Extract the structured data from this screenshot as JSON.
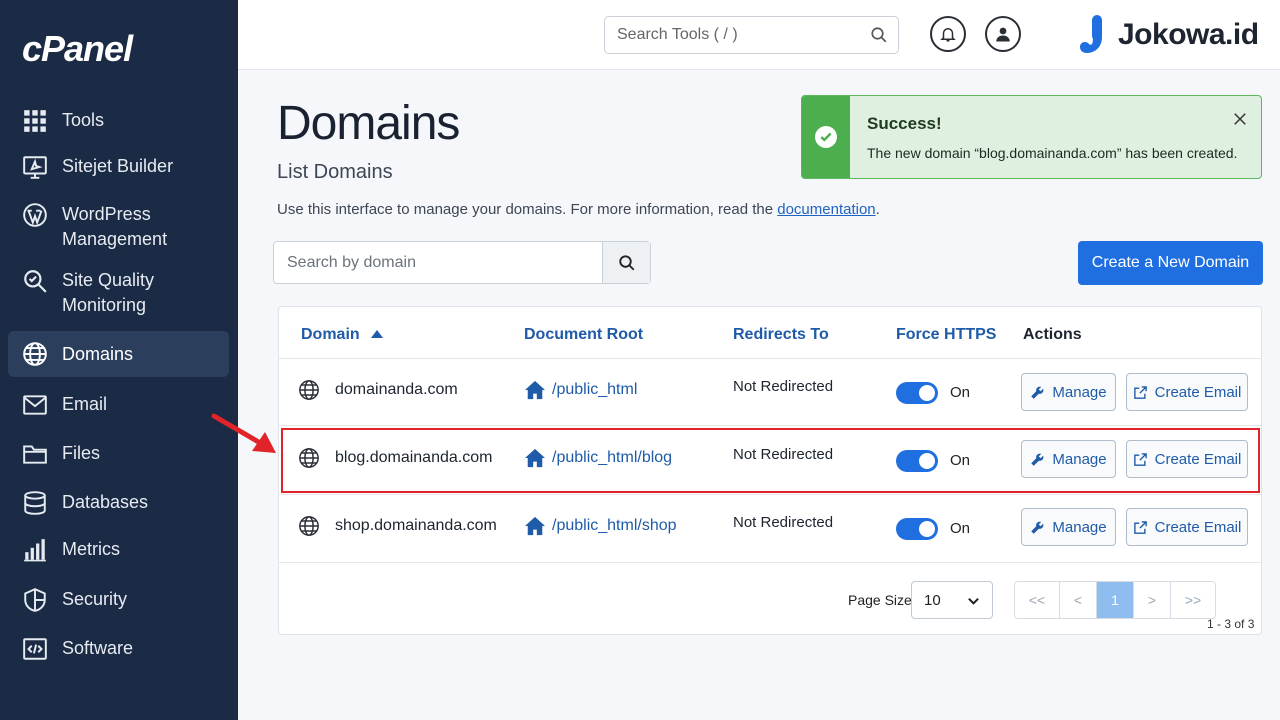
{
  "sidebar": {
    "logo": "cPanel",
    "items": [
      {
        "label": "Tools",
        "icon": "grid-icon"
      },
      {
        "label": "Sitejet Builder",
        "icon": "sitejet-icon"
      },
      {
        "label": "WordPress Management",
        "icon": "wordpress-icon"
      },
      {
        "label": "Site Quality Monitoring",
        "icon": "magnifier-icon"
      },
      {
        "label": "Domains",
        "icon": "globe-icon",
        "active": true
      },
      {
        "label": "Email",
        "icon": "envelope-icon"
      },
      {
        "label": "Files",
        "icon": "folder-icon"
      },
      {
        "label": "Databases",
        "icon": "database-icon"
      },
      {
        "label": "Metrics",
        "icon": "bar-chart-icon"
      },
      {
        "label": "Security",
        "icon": "shield-icon"
      },
      {
        "label": "Software",
        "icon": "code-icon"
      }
    ]
  },
  "header": {
    "search_placeholder": "Search Tools ( / )",
    "brand": "Jokowa.id"
  },
  "main": {
    "title": "Domains",
    "subtitle": "List Domains",
    "description": "Use this interface to manage your domains. For more information, read the",
    "doc_link": "documentation",
    "doc_suffix": ".",
    "search_placeholder": "Search by domain",
    "create_button": "Create a New Domain"
  },
  "alert": {
    "title": "Success!",
    "message": "The new domain “blog.domainanda.com” has been created.",
    "color": "#4cae4f"
  },
  "table": {
    "headers": {
      "domain": "Domain",
      "root": "Document Root",
      "redirects": "Redirects To",
      "https": "Force HTTPS",
      "actions": "Actions"
    },
    "rows": [
      {
        "domain": "domainanda.com",
        "root": "/public_html",
        "redirects": "Not Redirected",
        "https": "On",
        "https_enabled": true,
        "manage": "Manage",
        "email": "Create Email"
      },
      {
        "domain": "blog.domainanda.com",
        "root": "/public_html/blog",
        "redirects": "Not Redirected",
        "https": "On",
        "https_enabled": true,
        "manage": "Manage",
        "email": "Create Email",
        "highlighted": true
      },
      {
        "domain": "shop.domainanda.com",
        "root": "/public_html/shop",
        "redirects": "Not Redirected",
        "https": "On",
        "https_enabled": true,
        "manage": "Manage",
        "email": "Create Email"
      }
    ]
  },
  "pagination": {
    "page_size_label": "Page Size",
    "page_size": "10",
    "first": "<<",
    "prev": "<",
    "current": "1",
    "next": ">",
    "last": ">>",
    "range": "1 - 3 of 3"
  },
  "colors": {
    "sidebar_bg": "#1b2b45",
    "accent": "#1f6fe0",
    "link": "#1f5ba8",
    "highlight_border": "#e0242a"
  }
}
